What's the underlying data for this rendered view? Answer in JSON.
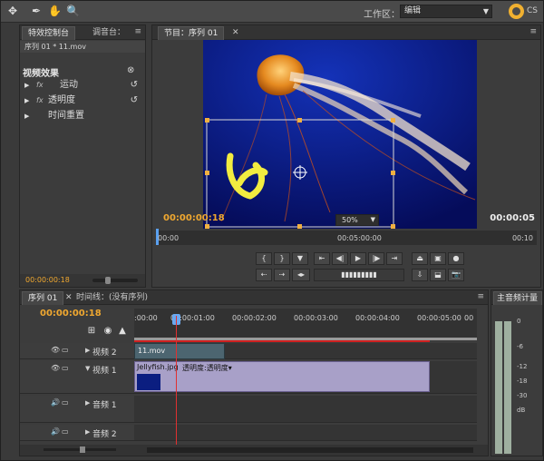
{
  "toolbar": {
    "workspace_label": "工作区：",
    "workspace_value": "编辑",
    "logo_text": "CS"
  },
  "effect_controls": {
    "tabs": [
      "特效控制台",
      "调音台："
    ],
    "clip_header": "序列 01 * 11.mov",
    "section": "视频效果",
    "effects": [
      "运动",
      "透明度",
      "时间重置"
    ],
    "timecode": "00:00:00:18"
  },
  "program_monitor": {
    "tab": "节目：序列 01",
    "zoom": "50%",
    "timecode": "00:00:00:18",
    "duration": "00:00:05",
    "ruler_start": "00:00",
    "ruler_mid": "00:05:00:00",
    "ruler_end": "00:10"
  },
  "timeline": {
    "tabs": [
      "序列 01",
      "时间线：(没有序列)"
    ],
    "timecode": "00:00:00:18",
    "ruler_ticks": [
      ":00:00",
      "00:00:01:00",
      "00:00:02:00",
      "00:00:03:00",
      "00:00:04:00",
      "00:00:05:00",
      "00"
    ],
    "tracks": [
      {
        "name": "视频 2"
      },
      {
        "name": "视频 1"
      },
      {
        "name": "音频 1"
      },
      {
        "name": "音频 2"
      }
    ],
    "clips": {
      "clip_11": "11.mov",
      "clip_jelly": "Jellyfish.jpg",
      "clip_jelly_opacity": "透明度:透明度▾"
    }
  },
  "audio_meters": {
    "title": "主音频计量",
    "scale": [
      "0",
      "-6",
      "-12",
      "-18",
      "-30",
      "dB"
    ]
  }
}
